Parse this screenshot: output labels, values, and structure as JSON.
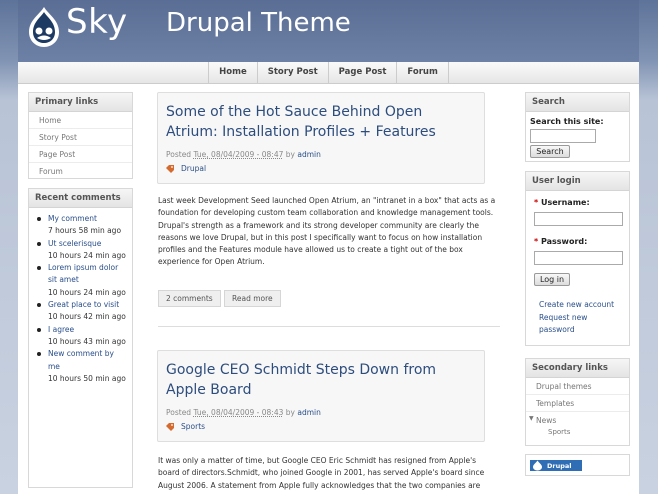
{
  "header": {
    "site_name": "Sky",
    "slogan": "Drupal Theme"
  },
  "nav": [
    "Home",
    "Story Post",
    "Page Post",
    "Forum"
  ],
  "primary_links": {
    "title": "Primary links",
    "items": [
      "Home",
      "Story Post",
      "Page Post",
      "Forum"
    ]
  },
  "recent_comments": {
    "title": "Recent comments",
    "items": [
      {
        "link": "My comment",
        "time": "7 hours 58 min ago"
      },
      {
        "link": "Ut scelerisque",
        "time": "10 hours 24 min ago"
      },
      {
        "link": "Lorem ipsum dolor sit amet",
        "time": "10 hours 24 min ago"
      },
      {
        "link": "Great place to visit",
        "time": "10 hours 42 min ago"
      },
      {
        "link": "I agree",
        "time": "10 hours 43 min ago"
      },
      {
        "link": "New comment by me",
        "time": "10 hours 50 min ago"
      }
    ]
  },
  "posts": [
    {
      "title": "Some of the Hot Sauce Behind Open Atrium: Installation Profiles + Features",
      "posted": "Posted",
      "date": "Tue, 08/04/2009 - 08:47",
      "by": "by",
      "author": "admin",
      "term": "Drupal",
      "body": "Last week Development Seed launched Open Atrium, an \"intranet in a box\" that acts as a foundation for developing custom team collaboration and knowledge management tools. Drupal's strength as a framework and its strong developer community are clearly the reasons we love Drupal, but in this post I specifically want to focus on how installation profiles and the Features module have allowed us to create a tight out of the box experience for Open Atrium.",
      "comments_link": "2 comments",
      "read_more": "Read more"
    },
    {
      "title": "Google CEO Schmidt Steps Down from Apple Board",
      "posted": "Posted",
      "date": "Tue, 08/04/2009 - 08:43",
      "by": "by",
      "author": "admin",
      "term": "Sports",
      "body": "It was only a matter of time, but Google CEO Eric Schmidt has resigned from Apple's board of directors.Schmidt, who joined Google in 2001, has served Apple's board since August 2006. A statement from Apple fully acknowledges that the two companies are"
    }
  ],
  "search": {
    "title": "Search",
    "label": "Search this site:",
    "value": "",
    "button": "Search"
  },
  "login": {
    "title": "User login",
    "username_label": "Username:",
    "password_label": "Password:",
    "required_mark": "*",
    "button": "Log in",
    "create_account": "Create new account",
    "request_password_line1": "Request new",
    "request_password_line2": "password"
  },
  "secondary_links": {
    "title": "Secondary links",
    "items": [
      "Drupal themes",
      "Templates",
      "News"
    ],
    "subitems": [
      "Sports"
    ]
  },
  "badge": {
    "text": "Drupal"
  },
  "colors": {
    "link": "#2a4f8a",
    "title": "#2d4d7d",
    "required": "#cc0000"
  }
}
